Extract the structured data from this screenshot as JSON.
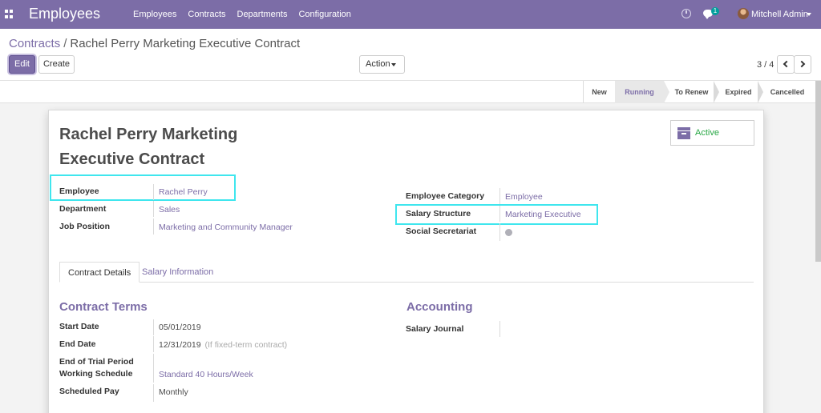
{
  "navbar": {
    "app_title": "Employees",
    "menu": [
      "Employees",
      "Contracts",
      "Departments",
      "Configuration"
    ],
    "chat_count": "1",
    "user_name": "Mitchell Admin",
    "accent": "#7c6da7"
  },
  "breadcrumb": {
    "parent": "Contracts",
    "separator": "/",
    "current": "Rachel Perry Marketing Executive Contract"
  },
  "toolbar": {
    "edit_label": "Edit",
    "create_label": "Create",
    "action_label": "Action"
  },
  "pager": {
    "value": "3 / 4"
  },
  "stages": [
    "New",
    "Running",
    "To Renew",
    "Expired",
    "Cancelled"
  ],
  "active_stage": "Running",
  "form": {
    "title_line1": "Rachel Perry Marketing",
    "title_line2": "Executive Contract",
    "active_label": "Active",
    "left_fields": [
      {
        "label": "Employee",
        "value": "Rachel Perry"
      },
      {
        "label": "Department",
        "value": "Sales"
      },
      {
        "label": "Job Position",
        "value": "Marketing and Community Manager"
      }
    ],
    "right_fields": [
      {
        "label": "Employee Category",
        "value": "Employee"
      },
      {
        "label": "Salary Structure",
        "value": "Marketing Executive"
      },
      {
        "label": "Social Secretariat",
        "value": ""
      }
    ],
    "tabs": [
      "Contract Details",
      "Salary Information"
    ],
    "contract_terms": {
      "title": "Contract Terms",
      "start_date_label": "Start Date",
      "start_date": "05/01/2019",
      "end_date_label": "End Date",
      "end_date": "12/31/2019",
      "end_date_hint": "(If fixed-term contract)",
      "trial_label": "End of Trial Period",
      "schedule_label": "Working Schedule",
      "schedule": "Standard 40 Hours/Week",
      "pay_label": "Scheduled Pay",
      "pay": "Monthly"
    },
    "accounting": {
      "title": "Accounting",
      "journal_label": "Salary Journal",
      "journal": ""
    }
  }
}
